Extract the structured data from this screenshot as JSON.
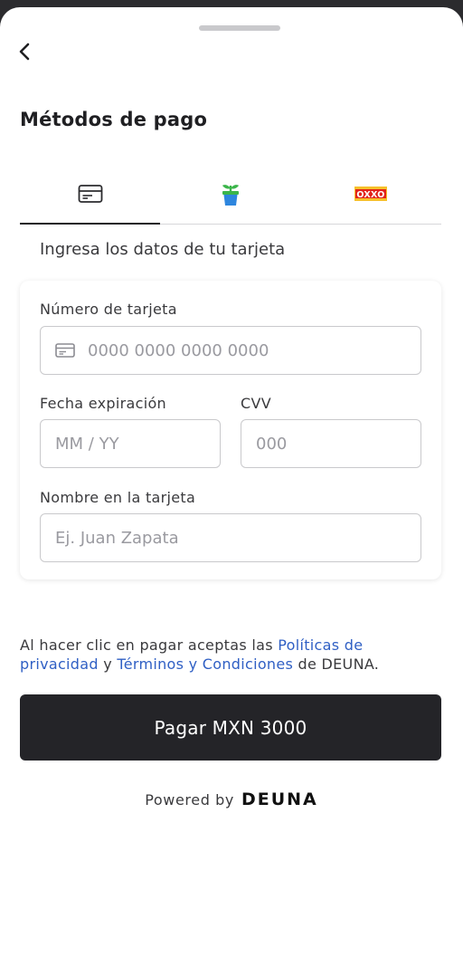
{
  "header": {
    "title": "Métodos de pago"
  },
  "tabs": [
    {
      "icon": "credit-card-icon",
      "active": true
    },
    {
      "icon": "plant-pot-icon",
      "active": false
    },
    {
      "icon": "oxxo-logo-icon",
      "active": false,
      "logo_text": "OXXO"
    }
  ],
  "form": {
    "subtitle": "Ingresa los datos de tu tarjeta",
    "card_number": {
      "label": "Número de tarjeta",
      "placeholder": "0000 0000 0000 0000",
      "value": ""
    },
    "expiry": {
      "label": "Fecha expiración",
      "placeholder": "MM / YY",
      "value": ""
    },
    "cvv": {
      "label": "CVV",
      "placeholder": "000",
      "value": ""
    },
    "cardholder": {
      "label": "Nombre en la tarjeta",
      "placeholder": "Ej. Juan Zapata",
      "value": ""
    }
  },
  "legal": {
    "prefix": "Al hacer clic en pagar aceptas las ",
    "privacy_link": "Políticas de privacidad",
    "middle": " y ",
    "terms_link": "Términos y Condiciones",
    "suffix": " de DEUNA."
  },
  "pay_button": {
    "label": "Pagar MXN 3000"
  },
  "footer": {
    "powered_by": "Powered by",
    "brand": "DEUNA"
  },
  "colors": {
    "primary": "#242428",
    "link": "#2f5fc4",
    "oxxo_red": "#e2231a",
    "oxxo_yellow": "#f6c12b",
    "pot_blue": "#2e86de",
    "leaf_green": "#3bb54a"
  }
}
